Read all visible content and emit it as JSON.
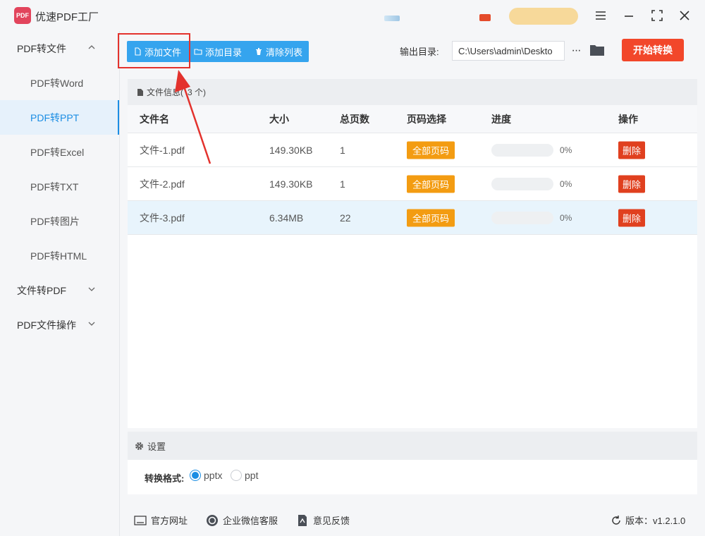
{
  "app": {
    "title": "优速PDF工厂",
    "logo_text": "PDF"
  },
  "sidebar": {
    "groups": [
      {
        "label": "PDF转文件",
        "expanded": true,
        "items": [
          {
            "label": "PDF转Word"
          },
          {
            "label": "PDF转PPT",
            "active": true
          },
          {
            "label": "PDF转Excel"
          },
          {
            "label": "PDF转TXT"
          },
          {
            "label": "PDF转图片"
          },
          {
            "label": "PDF转HTML"
          }
        ]
      },
      {
        "label": "文件转PDF",
        "expanded": false
      },
      {
        "label": "PDF文件操作",
        "expanded": false
      }
    ]
  },
  "toolbar": {
    "add_file": "添加文件",
    "add_folder": "添加目录",
    "clear_list": "清除列表",
    "output_label": "输出目录:",
    "output_path": "C:\\Users\\admin\\Deskto",
    "more": "···",
    "start": "开始转换"
  },
  "files": {
    "header_prefix": "文件信息(",
    "header_count": "3 个)",
    "columns": [
      "文件名",
      "大小",
      "总页数",
      "页码选择",
      "进度",
      "操作"
    ],
    "rows": [
      {
        "name": "文件-1.pdf",
        "size": "149.30KB",
        "pages": "1",
        "page_sel": "全部页码",
        "progress": 0,
        "progress_text": "0%",
        "action": "删除"
      },
      {
        "name": "文件-2.pdf",
        "size": "149.30KB",
        "pages": "1",
        "page_sel": "全部页码",
        "progress": 0,
        "progress_text": "0%",
        "action": "删除"
      },
      {
        "name": "文件-3.pdf",
        "size": "6.34MB",
        "pages": "22",
        "page_sel": "全部页码",
        "progress": 0,
        "progress_text": "0%",
        "action": "删除",
        "selected": true
      }
    ]
  },
  "settings": {
    "title": "设置",
    "format_label": "转换格式:",
    "options": [
      {
        "label": "pptx",
        "checked": true
      },
      {
        "label": "ppt",
        "checked": false
      }
    ]
  },
  "footer": {
    "website": "官方网址",
    "wechat": "企业微信客服",
    "feedback": "意见反馈",
    "version": "版本：v1.2.1.0"
  },
  "colors": {
    "accent": "#35a4ee",
    "primary": "#1b8de3",
    "start": "#f2472a",
    "page_btn": "#f39c12",
    "delete": "#e0401f",
    "annotation": "#e3322d"
  }
}
